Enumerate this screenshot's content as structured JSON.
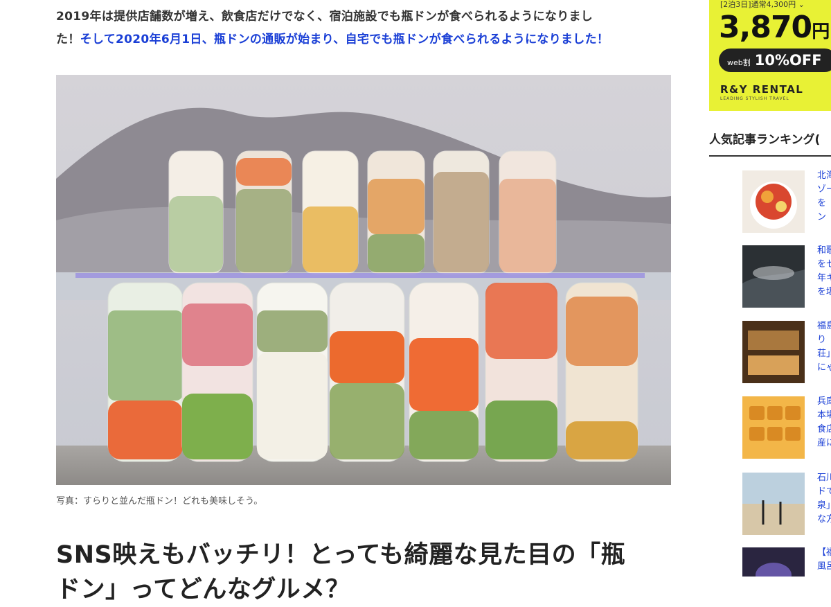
{
  "article": {
    "intro_line1": "2019年は提供店舗数が増え、飲食店だけでなく、宿泊施設でも瓶ドンが食べられるようになりまし",
    "intro_line2_plain": "た！",
    "intro_line2_highlight": "そして2020年6月1日、瓶ドンの通販が始まり、自宅でも瓶ドンが食べられるようになりました！",
    "caption": "写真：すらりと並んだ瓶ドン！どれも美味しそう。",
    "heading_line1": "SNS映えもバッチリ！とっても綺麗な見た目の「瓶",
    "heading_line2": "ドン」ってどんなグルメ？"
  },
  "sidebar": {
    "ad": {
      "topline": "[2泊3日]通常4,300円",
      "price": "3,870",
      "yen": "円",
      "badge_small": "web割",
      "badge_main": "10%OFF",
      "brand": "R&Y RENTAL",
      "tagline": "LEADING STYLISH TRAVEL"
    },
    "ranking_title": "人気記事ランキング(",
    "items": [
      {
        "text": "北海\nゾー\nを\nン"
      },
      {
        "text": "和歌\nをセ\n年キ\nを堪"
      },
      {
        "text": "福島\nり\n荘」\nにゃ"
      },
      {
        "text": "兵庫\n本場\n食店\n産に"
      },
      {
        "text": "石川\nドで\n泉」\nな方"
      },
      {
        "text": "【福\n風呂"
      }
    ]
  },
  "colors": {
    "accent_link": "#1a3fd6",
    "ad_background": "#e8f135"
  }
}
